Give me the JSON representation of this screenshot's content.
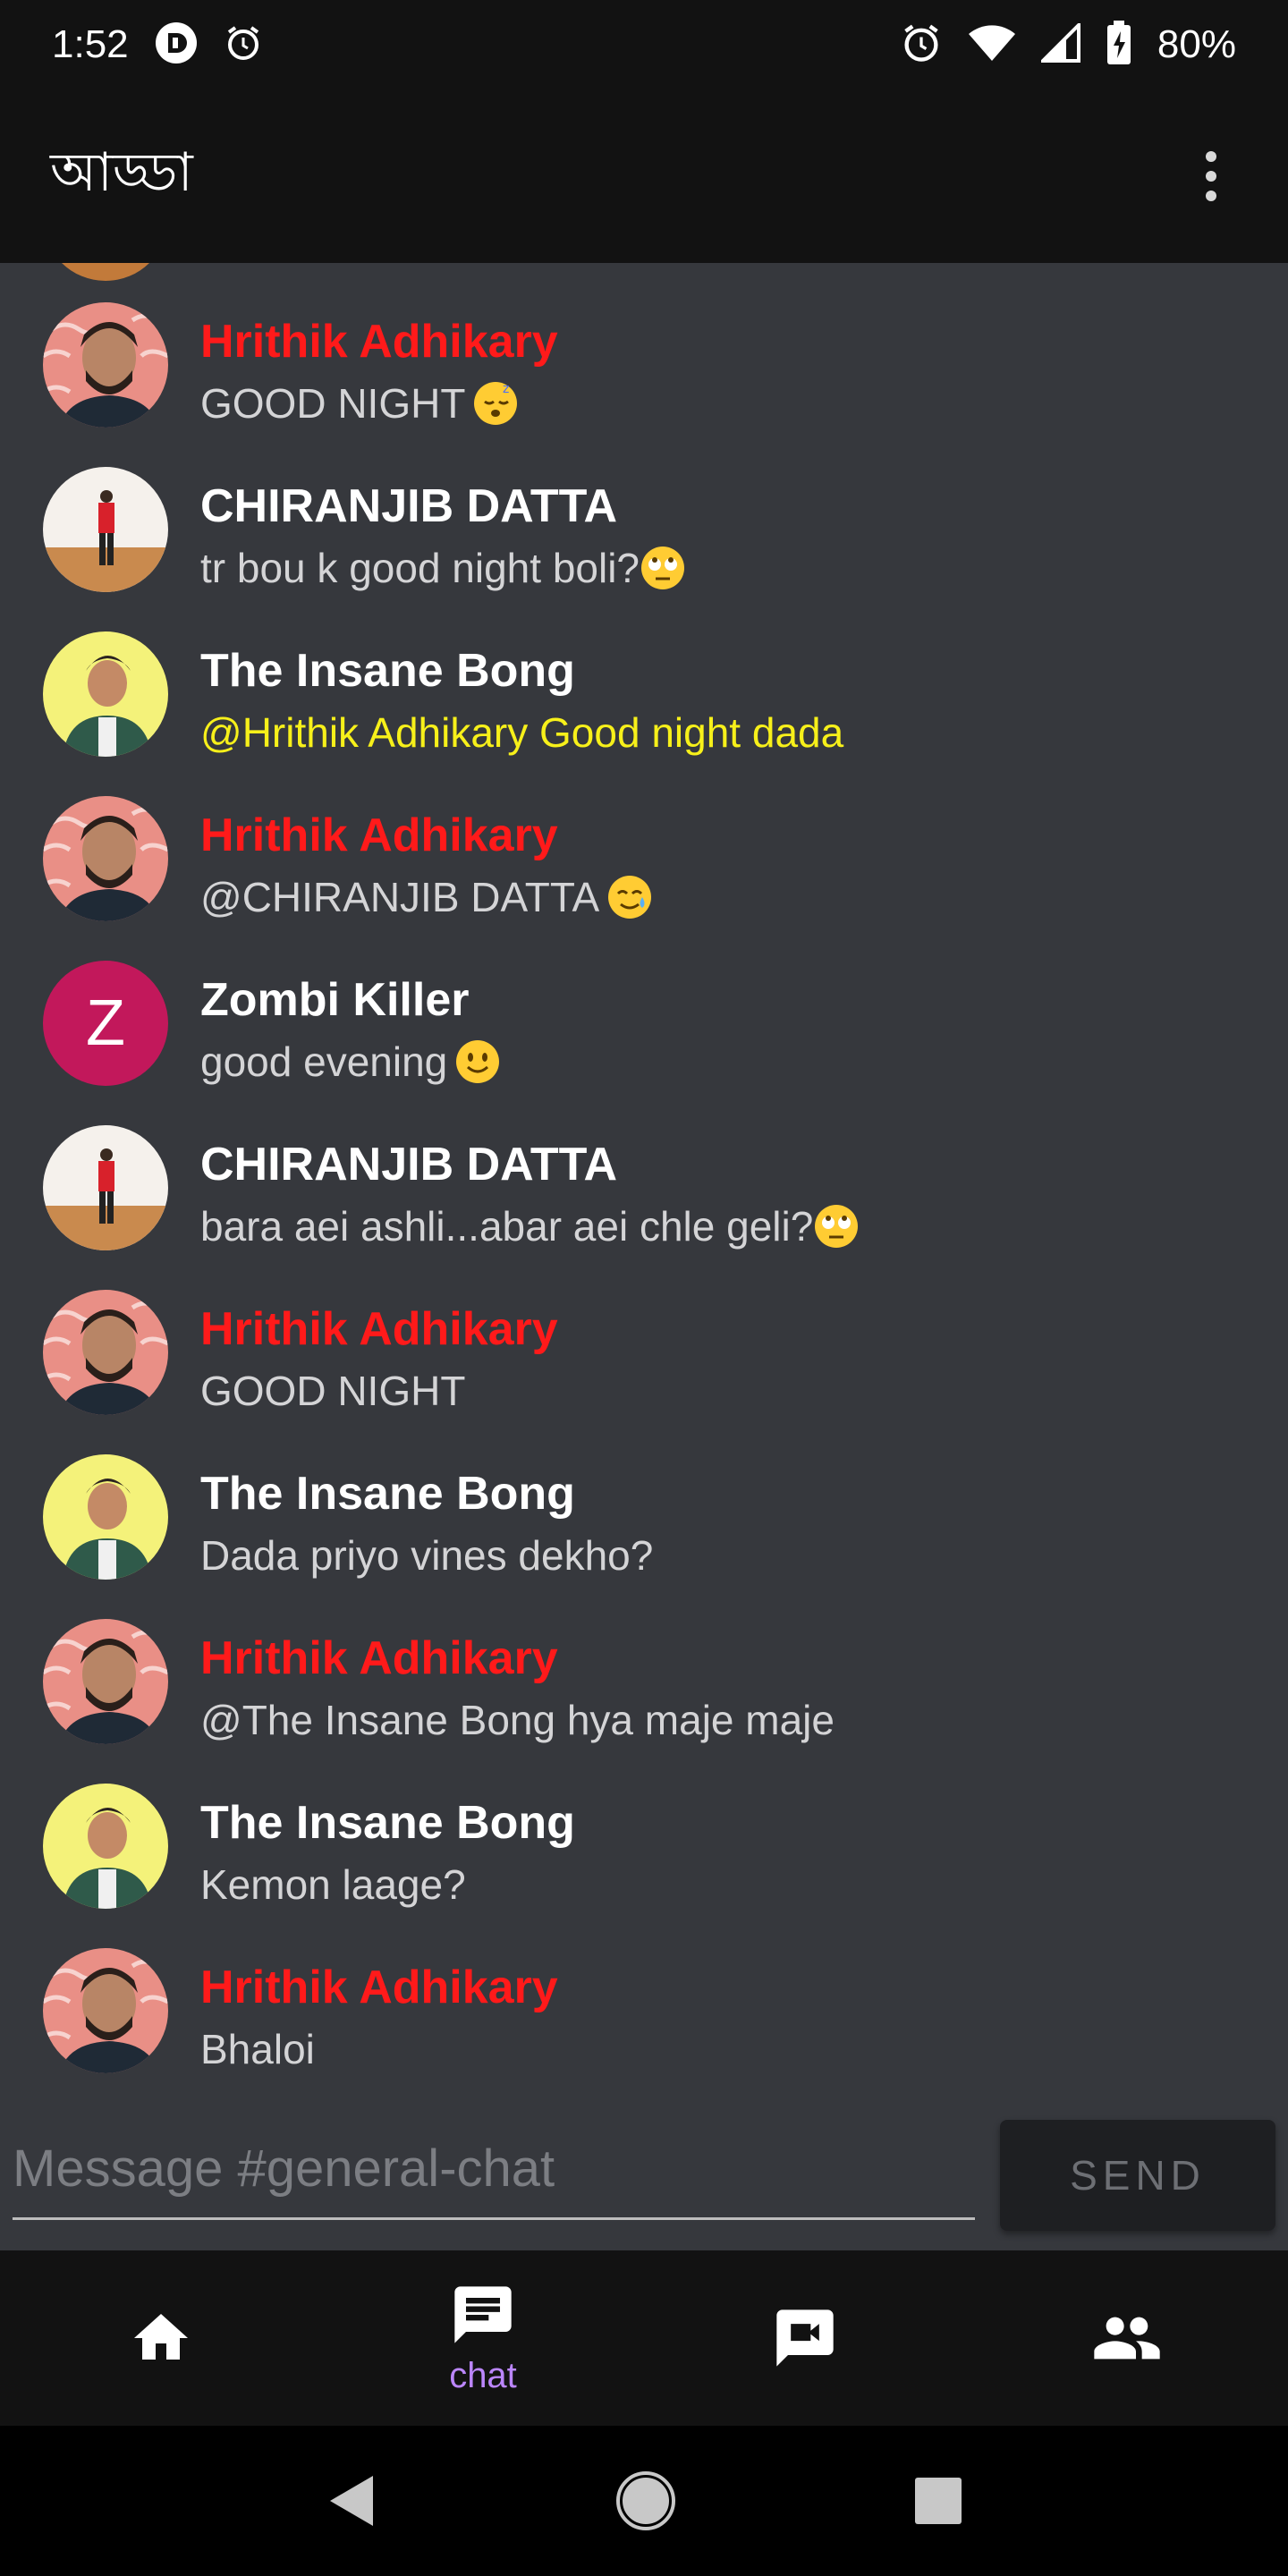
{
  "status_bar": {
    "time": "1:52",
    "battery_pct": "80%",
    "icons": [
      "notification-app-icon",
      "alarm-icon",
      "alarm-clock-icon",
      "wifi-icon",
      "signal-icon",
      "battery-charging-icon"
    ]
  },
  "app_bar": {
    "title": "আড্ডা",
    "menu_icon": "more-vert-icon"
  },
  "messages": [
    {
      "author": "Hrithik Adhikary",
      "author_color": "#ff1a1a",
      "text": "GOOD NIGHT",
      "emoji": "sleeping-face",
      "text_color": "#d4d4d6",
      "avatar": "hrithik"
    },
    {
      "author": "CHIRANJIB DATTA",
      "author_color": "#ffffff",
      "text": "tr bou k good night boli?",
      "emoji": "eye-roll-face",
      "text_color": "#d4d4d6",
      "avatar": "chiranjib"
    },
    {
      "author": "The Insane Bong",
      "author_color": "#ffffff",
      "text": "@Hrithik Adhikary Good night dada",
      "emoji": "",
      "text_color": "#f7f01a",
      "avatar": "insane"
    },
    {
      "author": "Hrithik Adhikary",
      "author_color": "#ff1a1a",
      "text": "@CHIRANJIB DATTA",
      "emoji": "tear-smile-face",
      "text_color": "#d4d4d6",
      "avatar": "hrithik"
    },
    {
      "author": "Zombi Killer",
      "author_color": "#ffffff",
      "text": "good evening",
      "emoji": "slight-smile-face",
      "text_color": "#d4d4d6",
      "avatar": "letter",
      "avatar_letter": "Z"
    },
    {
      "author": "CHIRANJIB DATTA",
      "author_color": "#ffffff",
      "text": "bara aei ashli...abar aei chle geli?",
      "emoji": "eye-roll-face",
      "text_color": "#d4d4d6",
      "avatar": "chiranjib"
    },
    {
      "author": "Hrithik Adhikary",
      "author_color": "#ff1a1a",
      "text": "GOOD NIGHT",
      "emoji": "",
      "text_color": "#d4d4d6",
      "avatar": "hrithik"
    },
    {
      "author": "The Insane Bong",
      "author_color": "#ffffff",
      "text": "Dada priyo vines dekho?",
      "emoji": "",
      "text_color": "#d4d4d6",
      "avatar": "insane"
    },
    {
      "author": "Hrithik Adhikary",
      "author_color": "#ff1a1a",
      "text": "@The Insane Bong hya maje maje",
      "emoji": "",
      "text_color": "#d4d4d6",
      "avatar": "hrithik"
    },
    {
      "author": "The Insane Bong",
      "author_color": "#ffffff",
      "text": "Kemon laage?",
      "emoji": "",
      "text_color": "#d4d4d6",
      "avatar": "insane"
    },
    {
      "author": "Hrithik Adhikary",
      "author_color": "#ff1a1a",
      "text": "Bhaloi",
      "emoji": "",
      "text_color": "#d4d4d6",
      "avatar": "hrithik"
    }
  ],
  "composer": {
    "placeholder": "Message #general-chat",
    "send_label": "SEND"
  },
  "bottom_nav": {
    "items": [
      {
        "icon": "home-icon",
        "label": ""
      },
      {
        "icon": "chat-icon",
        "label": "chat",
        "active": true
      },
      {
        "icon": "video-chat-icon",
        "label": ""
      },
      {
        "icon": "people-icon",
        "label": ""
      }
    ],
    "active_color": "#bb86fc"
  },
  "system_nav": {
    "icons": [
      "back-icon",
      "home-circle-icon",
      "recents-icon"
    ]
  }
}
